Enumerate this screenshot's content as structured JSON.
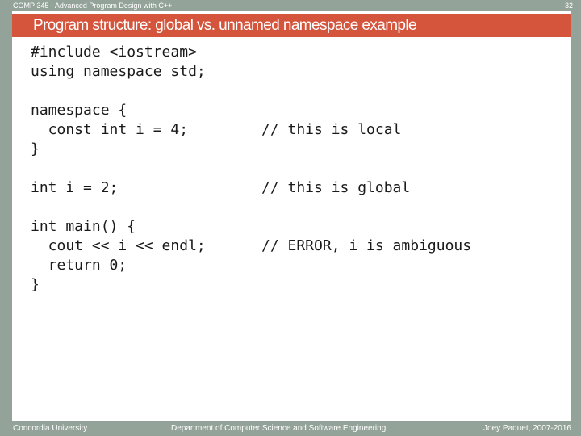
{
  "header": {
    "course": "COMP 345 - Advanced Program Design with C++",
    "page_number": "32"
  },
  "title": "Program structure: global vs. unnamed namespace example",
  "code_lines": [
    "#include <iostream>",
    "using namespace std;",
    "namespace {",
    "  const int i = 4;",
    "}",
    "int i = 2;",
    "int main() {",
    "  cout << i << endl;",
    "  return 0;",
    "}"
  ],
  "comments": [
    "// this is local",
    "// this is global",
    "// ERROR, i is ambiguous"
  ],
  "footer": {
    "left": "Concordia University",
    "center": "Department of Computer Science and Software Engineering",
    "right": "Joey Paquet, 2007-2016"
  },
  "colors": {
    "title_bar": "#d4543c",
    "frame": "#94a39a"
  }
}
